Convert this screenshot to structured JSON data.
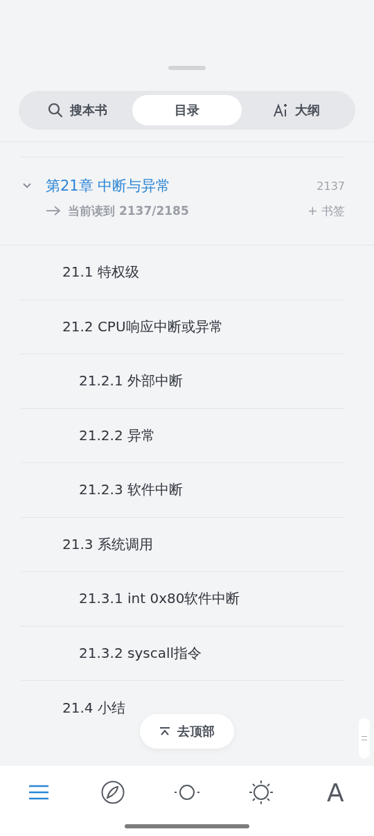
{
  "tabs": [
    {
      "kind": "search",
      "label": "搜本书",
      "selected": false
    },
    {
      "kind": "toc",
      "label": "目录",
      "selected": true
    },
    {
      "kind": "outline",
      "label": "大纲",
      "selected": false
    }
  ],
  "chapter": {
    "title": "第21章 中断与异常",
    "page": "2137",
    "expanded": true,
    "progress": "当前读到 2137/2185",
    "bookmark": "+ 书签",
    "children": [
      {
        "title": "21.1 特权级"
      },
      {
        "title": "21.2 CPU响应中断或异常",
        "children": [
          {
            "title": "21.2.1 外部中断"
          },
          {
            "title": "21.2.2 异常"
          },
          {
            "title": "21.2.3 软件中断"
          }
        ]
      },
      {
        "title": "21.3 系统调用",
        "children": [
          {
            "title": "21.3.1 int 0x80软件中断"
          },
          {
            "title": "21.3.2 syscall指令"
          }
        ]
      },
      {
        "title": "21.4 小结"
      }
    ]
  },
  "top_button": "去顶部",
  "nav": [
    {
      "kind": "menu",
      "selected": true
    },
    {
      "kind": "compass",
      "selected": false
    },
    {
      "kind": "progress",
      "selected": false
    },
    {
      "kind": "brightness",
      "selected": false
    },
    {
      "kind": "font",
      "label": "A",
      "selected": false
    }
  ]
}
